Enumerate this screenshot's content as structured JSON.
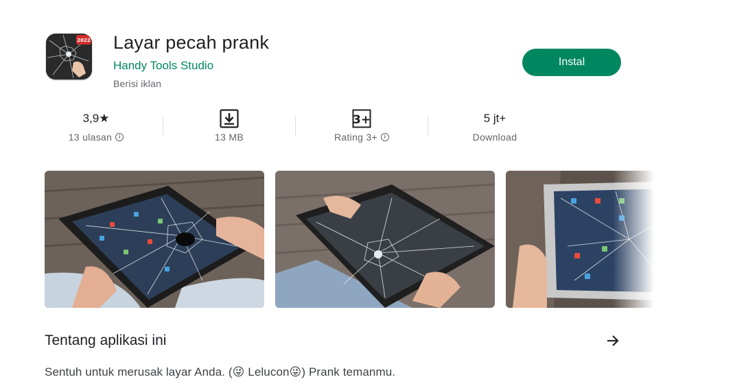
{
  "app": {
    "title": "Layar pecah prank",
    "developer": "Handy Tools Studio",
    "ads_note": "Berisi iklan",
    "icon_badge": "2022",
    "install_label": "Instal"
  },
  "stats": [
    {
      "top": "3,9★",
      "bottom": "13 ulasan"
    },
    {
      "top_icon": "download-icon",
      "bottom": "13 MB"
    },
    {
      "top_icon": "rating-3plus-icon",
      "top_badge": "3+",
      "bottom": "Rating 3+"
    },
    {
      "top": "5 jt+",
      "bottom": "Download"
    }
  ],
  "about": {
    "title": "Tentang aplikasi ini",
    "description": "Sentuh untuk merusak layar Anda. (😜 Lelucon😜) Prank temanmu."
  },
  "colors": {
    "accent": "#01875f",
    "text": "#202124",
    "secondary": "#5f6368"
  }
}
